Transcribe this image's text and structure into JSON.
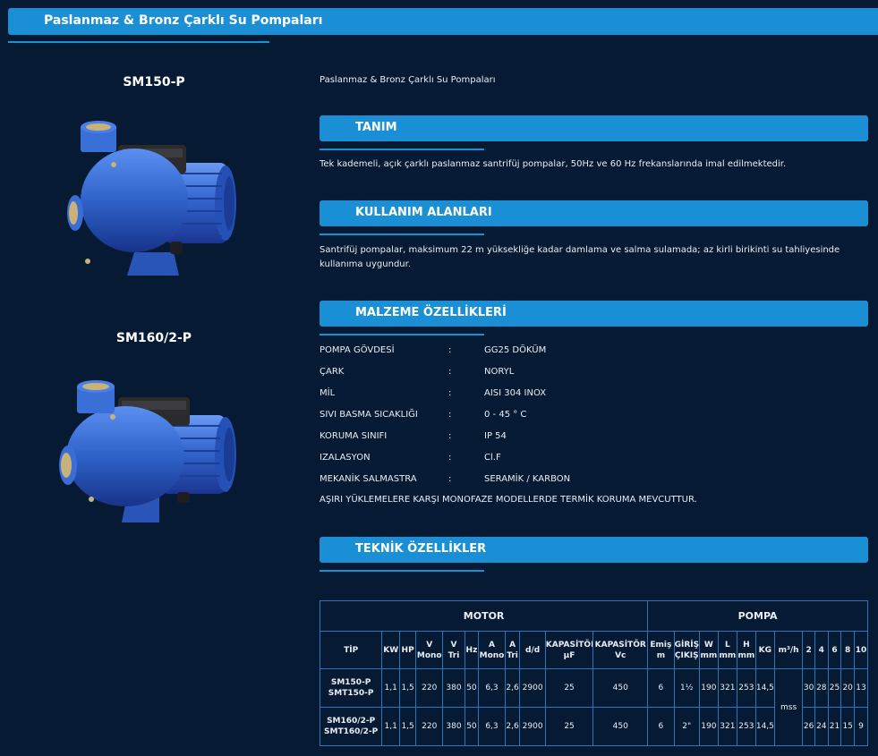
{
  "page": {
    "title": "Paslanmaz & Bronz Çarklı Su Pompaları"
  },
  "colors": {
    "background": "#061a34",
    "accent": "#1b8fd6",
    "pump_blue": "#2e62c8"
  },
  "products": [
    {
      "name": "SM150-P"
    },
    {
      "name": "SM160/2-P"
    }
  ],
  "intro": "Paslanmaz & Bronz Çarklı Su Pompaları",
  "sections": {
    "tanim": {
      "title": "TANIM",
      "text": "Tek kademeli, açık çarklı paslanmaz santrifüj pompalar, 50Hz ve 60 Hz frekanslarında imal edilmektedir."
    },
    "kullanim": {
      "title": "KULLANIM ALANLARI",
      "text": "Santrifüj pompalar, maksimum 22 m yüksekliğe kadar damlama ve salma sulamada; az kirli birikinti su tahliyesinde kullanıma uygundur."
    },
    "malzeme": {
      "title": "MALZEME ÖZELLİKLERİ",
      "rows": [
        {
          "key": "POMPA GÖVDESİ",
          "sep": ":",
          "value": "GG25 DÖKÜM"
        },
        {
          "key": "ÇARK",
          "sep": ":",
          "value": "NORYL"
        },
        {
          "key": "MİL",
          "sep": ":",
          "value": "AISI 304 INOX"
        },
        {
          "key": "SIVI BASMA SICAKLIĞI",
          "sep": ":",
          "value": "0 - 45 ° C"
        },
        {
          "key": "KORUMA SINIFI",
          "sep": ":",
          "value": "IP 54"
        },
        {
          "key": "IZALASYON",
          "sep": ":",
          "value": "Cl.F"
        },
        {
          "key": "MEKANİK SALMASTRA",
          "sep": ":",
          "value": "SERAMİK / KARBON"
        }
      ],
      "note": "AŞIRI YÜKLEMELERE KARŞI MONOFAZE MODELLERDE TERMİK KORUMA MEVCUTTUR."
    },
    "teknik": {
      "title": "TEKNİK ÖZELLİKLER"
    }
  },
  "tech_table": {
    "group_motor": "MOTOR",
    "group_pompa": "POMPA",
    "headers": {
      "tip": "TİP",
      "kw": "KW",
      "hp": "HP",
      "v_mono_1": "V",
      "v_mono_2": "Mono",
      "v_tri_1": "V",
      "v_tri_2": "Tri",
      "hz": "Hz",
      "a_mono_1": "A",
      "a_mono_2": "Mono",
      "a_tri_1": "A",
      "a_tri_2": "Tri",
      "dd": "d/d",
      "kap_uf_1": "KAPASİTÖR",
      "kap_uf_2": "µF",
      "kap_vc_1": "KAPASİTÖR",
      "kap_vc_2": "Vc",
      "emis_1": "Emiş",
      "emis_2": "m",
      "giris_1": "GİRİŞ",
      "giris_2": "ÇIKIŞ",
      "w_1": "W",
      "w_2": "mm",
      "l_1": "L",
      "l_2": "mm",
      "h_1": "H",
      "h_2": "mm",
      "kg": "KG",
      "m3h": "m³/h",
      "q2": "2",
      "q4": "4",
      "q6": "6",
      "q8": "8",
      "q10": "10"
    },
    "mss": "mss",
    "rows": [
      {
        "tip_1": "SM150-P",
        "tip_2": "SMT150-P",
        "kw": "1,1",
        "hp": "1,5",
        "v_mono": "220",
        "v_tri": "380",
        "hz": "50",
        "a_mono": "6,3",
        "a_tri": "2,6",
        "dd": "2900",
        "kap_uf": "25",
        "kap_vc": "450",
        "emis": "6",
        "giris": "1½",
        "w": "190",
        "l": "321",
        "h": "253",
        "kg": "14,5",
        "q2": "30",
        "q4": "28",
        "q6": "25",
        "q8": "20",
        "q10": "13"
      },
      {
        "tip_1": "SM160/2-P",
        "tip_2": "SMT160/2-P",
        "kw": "1,1",
        "hp": "1,5",
        "v_mono": "220",
        "v_tri": "380",
        "hz": "50",
        "a_mono": "6,3",
        "a_tri": "2,6",
        "dd": "2900",
        "kap_uf": "25",
        "kap_vc": "450",
        "emis": "6",
        "giris": "2\"",
        "w": "190",
        "l": "321",
        "h": "253",
        "kg": "14,5",
        "q2": "26",
        "q4": "24",
        "q6": "21",
        "q8": "15",
        "q10": "9"
      }
    ]
  }
}
